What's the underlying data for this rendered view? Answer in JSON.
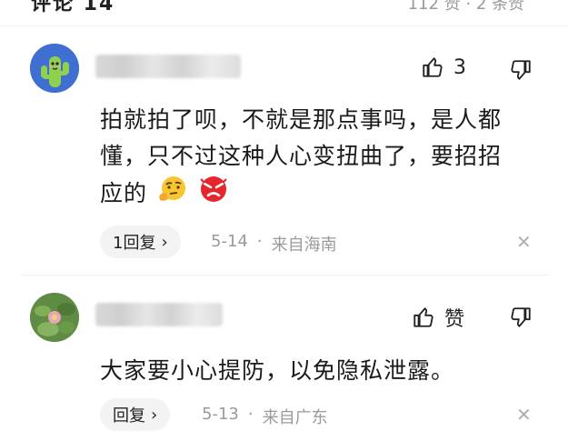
{
  "header": {
    "left_text": "评论 14",
    "right_text": "112 赞 · 2 条赞"
  },
  "comments": [
    {
      "username": "",
      "like_count": "3",
      "content_line1": "拍就拍了呗，不就是那点事吗，是人都",
      "content_line2": "懂，只不过这种人心变扭曲了，要招招",
      "content_line3": "应的",
      "emojis": [
        "thinking-face-emoji",
        "angry-face-emoji"
      ],
      "reply_label": "1回复",
      "date": "5-14",
      "dot": "·",
      "location": "来自海南"
    },
    {
      "username": "",
      "like_label": "赞",
      "content_line1": "大家要小心提防，以免隐私泄露。",
      "reply_label": "回复",
      "date": "5-13",
      "dot": "·",
      "location": "来自广东"
    }
  ],
  "icons": {
    "like": "thumbs-up-icon",
    "dislike": "thumbs-down-icon",
    "chevron": "chevron-right-icon",
    "close": "close-icon"
  },
  "colors": {
    "pill_bg": "#f3f3f3",
    "meta_text": "#9a9a9a",
    "avatar1_bg": "#3f6fd0",
    "cactus": "#8fd14f"
  }
}
